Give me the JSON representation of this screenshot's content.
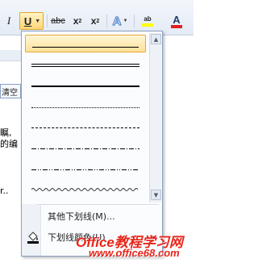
{
  "toolbar": {
    "italic_label": "I",
    "underline_label": "U",
    "strikethrough_label": "abc",
    "subscript_label": "x",
    "subscript_mark": "2",
    "superscript_label": "x",
    "superscript_mark": "2",
    "text_effect_label": "A",
    "highlight_label": "ab",
    "font_color_label": "A",
    "colors": {
      "highlight": "#ffff00",
      "font_color": "#e01f1f",
      "active_border": "#e0a53a"
    }
  },
  "document": {
    "clear_label": "清空",
    "snippet_1": "瞩,",
    "snippet_2": "的编",
    "snippet_3": "r.."
  },
  "underline_menu": {
    "line_styles": [
      "single",
      "double",
      "thick",
      "dotted",
      "dashed",
      "dash-dot",
      "dash-dot-dot",
      "wave"
    ],
    "selected": "single",
    "more_underlines": "其他下划线(M)...",
    "underline_color": "下划线颜色(U)"
  },
  "watermark": {
    "line1": "Office教程学习网",
    "line2": "www.office68.com"
  }
}
